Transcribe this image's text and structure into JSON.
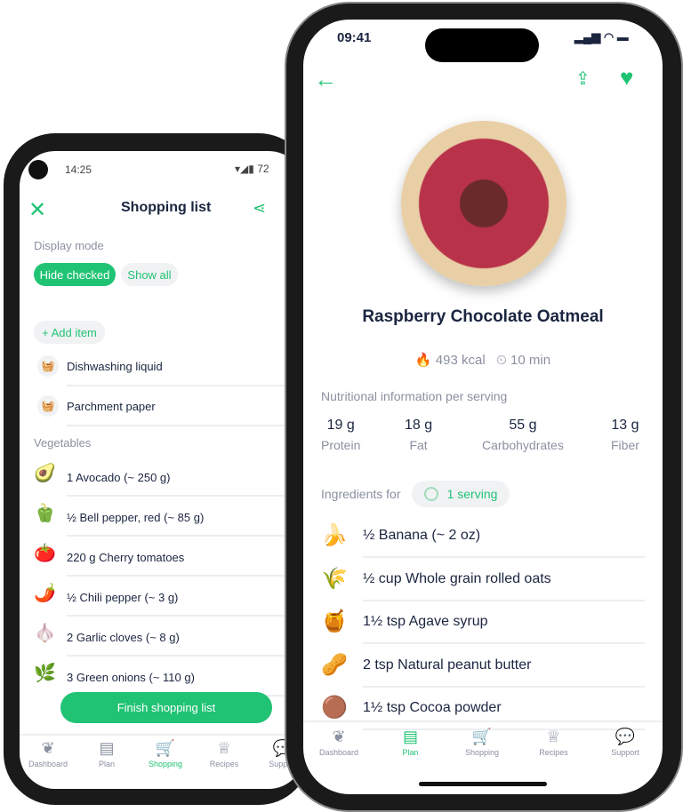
{
  "back": {
    "status": {
      "time": "14:25",
      "battery": "72"
    },
    "header": {
      "title": "Shopping list",
      "close_icon": "close-icon",
      "share_icon": "share-icon"
    },
    "display_mode": {
      "label": "Display mode",
      "hide_checked": "Hide checked",
      "show_all": "Show all",
      "selected": "Hide checked"
    },
    "add_item": "+ Add item",
    "misc_items": [
      "Dishwashing liquid",
      "Parchment paper"
    ],
    "vegetables": {
      "label": "Vegetables",
      "items": [
        {
          "emoji": "🥑",
          "text": "1 Avocado (~ 250 g)"
        },
        {
          "emoji": "🫑",
          "text": "½ Bell pepper, red (~ 85 g)"
        },
        {
          "emoji": "🍅",
          "text": "220 g Cherry tomatoes"
        },
        {
          "emoji": "🌶️",
          "text": "½ Chili pepper (~ 3 g)"
        },
        {
          "emoji": "🧄",
          "text": "2 Garlic cloves (~ 8 g)"
        },
        {
          "emoji": "🌿",
          "text": "3 Green onions (~ 110 g)"
        }
      ]
    },
    "finish_button": "Finish shopping list",
    "nav": [
      {
        "label": "Dashboard",
        "icon": "leaf-icon"
      },
      {
        "label": "Plan",
        "icon": "clipboard-icon"
      },
      {
        "label": "Shopping",
        "icon": "cart-icon",
        "active": true
      },
      {
        "label": "Recipes",
        "icon": "chef-hat-icon"
      },
      {
        "label": "Support",
        "icon": "chat-icon"
      }
    ]
  },
  "front": {
    "status": {
      "time": "09:41"
    },
    "recipe": {
      "title": "Raspberry Chocolate Oatmeal",
      "kcal": "493 kcal",
      "time": "10 min"
    },
    "nutrition": {
      "label": "Nutritional information per serving",
      "items": [
        {
          "value": "19 g",
          "label": "Protein"
        },
        {
          "value": "18 g",
          "label": "Fat"
        },
        {
          "value": "55 g",
          "label": "Carbohydrates"
        },
        {
          "value": "13 g",
          "label": "Fiber"
        }
      ]
    },
    "ingredients": {
      "label": "Ingredients for",
      "serving": "1 serving",
      "items": [
        {
          "emoji": "🍌",
          "text": "½ Banana (~ 2 oz)"
        },
        {
          "emoji": "🌾",
          "text": "½ cup Whole grain rolled oats"
        },
        {
          "emoji": "🍯",
          "text": "1½ tsp Agave syrup"
        },
        {
          "emoji": "🥜",
          "text": "2 tsp Natural peanut butter"
        },
        {
          "emoji": "🟤",
          "text": "1½ tsp Cocoa powder"
        }
      ]
    },
    "nav": [
      {
        "label": "Dashboard",
        "icon": "leaf-icon"
      },
      {
        "label": "Plan",
        "icon": "clipboard-icon",
        "active": true
      },
      {
        "label": "Shopping",
        "icon": "cart-icon"
      },
      {
        "label": "Recipes",
        "icon": "chef-hat-icon"
      },
      {
        "label": "Support",
        "icon": "chat-icon"
      }
    ]
  },
  "colors": {
    "accent": "#20c374",
    "text": "#1b2540",
    "muted": "#8a90a0"
  }
}
